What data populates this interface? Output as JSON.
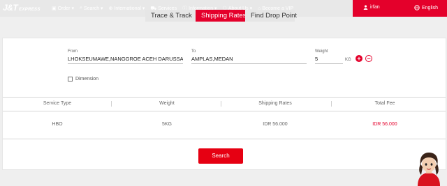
{
  "header": {
    "logo_main": "J&T",
    "logo_sub": "EXPRESS",
    "nav": [
      {
        "icon": "cube-icon",
        "glyph": "▣",
        "label": "Order ▾"
      },
      {
        "icon": "search-icon",
        "glyph": "⌕",
        "label": "Search ▾"
      },
      {
        "icon": "globe-icon",
        "glyph": "⊕",
        "label": "International ▾"
      },
      {
        "icon": "truck-icon",
        "glyph": "⛟",
        "label": "Services"
      },
      {
        "icon": "info-icon",
        "glyph": "ⓘ",
        "label": "Information ▾"
      },
      {
        "icon": "group-icon",
        "glyph": "⚇",
        "label": "About Us ▾"
      },
      {
        "icon": "vip-icon",
        "glyph": "⌂",
        "label": "Become a VIP"
      }
    ],
    "user_name": "irfan",
    "language": "English"
  },
  "tabs": [
    "Trace & Track",
    "Shipping Rates",
    "Find Drop Point"
  ],
  "active_tab": "Shipping Rates",
  "form": {
    "from_label": "From",
    "from_value": "LHOKSEUMAWE,NANGGROE ACEH DARUSSALAM",
    "to_label": "To",
    "to_value": "AMPLAS,MEDAN",
    "weight_label": "Weight",
    "weight_value": "5",
    "weight_unit": "KG",
    "dimension_label": "Dimension"
  },
  "table": {
    "headers": [
      "Service Type",
      "Weight",
      "Shipping Rates",
      "Total Fee"
    ],
    "rows": [
      {
        "service": "HBO",
        "weight": "5KG",
        "rate": "IDR 56.000",
        "total": "IDR 56.000"
      }
    ]
  },
  "search_button": "Search",
  "colors": {
    "brand_red": "#e4002b"
  }
}
